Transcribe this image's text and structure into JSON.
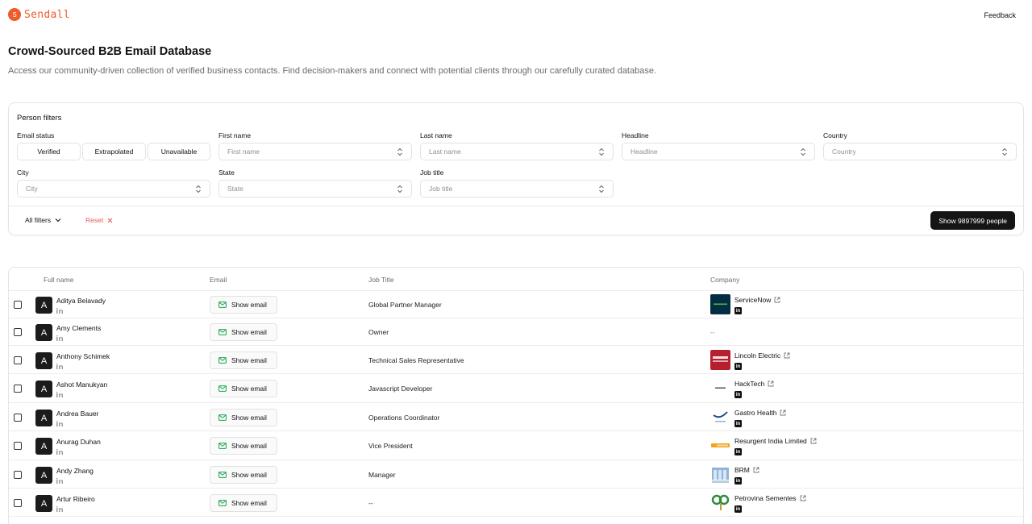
{
  "header": {
    "logo_letter": "S",
    "logo_text": "Sendall",
    "feedback": "Feedback"
  },
  "page": {
    "title": "Crowd-Sourced B2B Email Database",
    "subtitle": "Access our community-driven collection of verified business contacts. Find decision-makers and connect with potential clients through our carefully curated database."
  },
  "filters": {
    "title": "Person filters",
    "email_status": {
      "label": "Email status",
      "options": [
        "Verified",
        "Extrapolated",
        "Unavailable"
      ]
    },
    "first_name": {
      "label": "First name",
      "placeholder": "First name"
    },
    "last_name": {
      "label": "Last name",
      "placeholder": "Last name"
    },
    "headline": {
      "label": "Headline",
      "placeholder": "Headline"
    },
    "country": {
      "label": "Country",
      "placeholder": "Country"
    },
    "city": {
      "label": "City",
      "placeholder": "City"
    },
    "state": {
      "label": "State",
      "placeholder": "State"
    },
    "job_title": {
      "label": "Job title",
      "placeholder": "Job title"
    },
    "all_filters": "All filters",
    "reset": "Reset",
    "show_button": "Show 9897999 people"
  },
  "table": {
    "columns": [
      "Full name",
      "Email",
      "Job Title",
      "Company"
    ],
    "email_button": "Show email",
    "rows": [
      {
        "initial": "A",
        "name": "Aditya Belavady",
        "job": "Global Partner Manager",
        "company": "ServiceNow",
        "logo": "servicenow"
      },
      {
        "initial": "A",
        "name": "Amy Clements",
        "job": "Owner",
        "company": "--",
        "logo": ""
      },
      {
        "initial": "A",
        "name": "Anthony Schimek",
        "job": "Technical Sales Representative",
        "company": "Lincoln Electric",
        "logo": "lincoln"
      },
      {
        "initial": "A",
        "name": "Ashot Manukyan",
        "job": "Javascript Developer",
        "company": "HackTech",
        "logo": "hacktech"
      },
      {
        "initial": "A",
        "name": "Andrea Bauer",
        "job": "Operations Coordinator",
        "company": "Gastro Health",
        "logo": "gastro"
      },
      {
        "initial": "A",
        "name": "Anurag Duhan",
        "job": "Vice President",
        "company": "Resurgent India Limited",
        "logo": "resurgent"
      },
      {
        "initial": "A",
        "name": "Andy Zhang",
        "job": "Manager",
        "company": "BRM",
        "logo": "brm"
      },
      {
        "initial": "A",
        "name": "Artur Ribeiro",
        "job": "--",
        "company": "Petrovina Sementes",
        "logo": "petrovina"
      }
    ]
  },
  "colors": {
    "brand": "#ef5b2b",
    "primary_button": "#151515",
    "reset": "#e35c5c"
  }
}
